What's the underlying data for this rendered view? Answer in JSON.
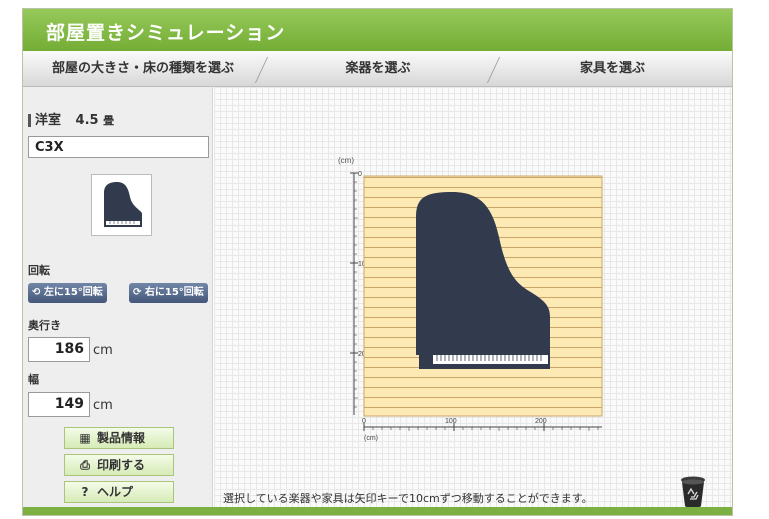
{
  "app": {
    "title": "部屋置きシミュレーション"
  },
  "tabs": [
    {
      "label": "部屋の大きさ・床の種類を選ぶ"
    },
    {
      "label": "楽器を選ぶ"
    },
    {
      "label": "家具を選ぶ"
    }
  ],
  "side": {
    "room_type": "洋室",
    "room_size": "4.5",
    "room_unit": "畳",
    "model": "C3X",
    "rotate_label": "回転",
    "rotate_left": "左に15°回転",
    "rotate_right": "右に15°回転",
    "depth_label": "奥行き",
    "depth_value": "186",
    "width_label": "幅",
    "width_value": "149",
    "unit": "cm",
    "buttons": {
      "info": "製品情報",
      "print": "印刷する",
      "help": "ヘルプ"
    }
  },
  "canvas": {
    "unit_label": "(cm)",
    "y_ticks": [
      "0",
      "100",
      "200"
    ],
    "x_ticks": [
      "0",
      "100",
      "200"
    ],
    "hint": "選択している楽器や家具は矢印キーで10cmずつ移動することができます。"
  },
  "icons": [
    "rotate-left-icon",
    "rotate-right-icon",
    "info-icon",
    "printer-icon",
    "help-icon",
    "trash-icon"
  ],
  "colors": {
    "accent": "#7db043",
    "piano": "#323b4e",
    "floor": "#fde9b4",
    "floor_line": "#c9a56a"
  }
}
